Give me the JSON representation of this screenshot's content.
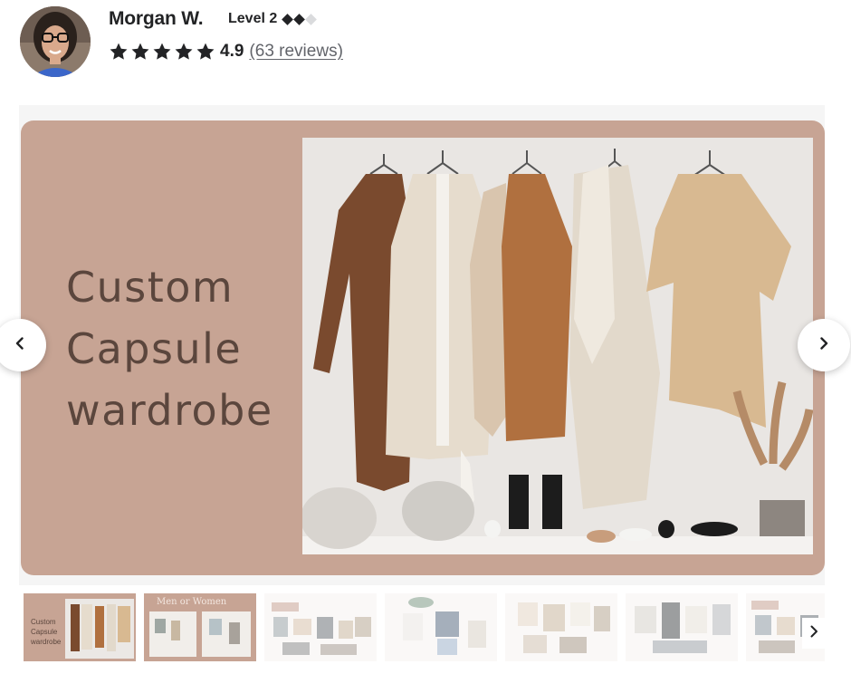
{
  "seller": {
    "name": "Morgan W.",
    "level_label": "Level 2",
    "level_diamonds_filled": 2,
    "level_diamonds_total": 3,
    "rating": "4.9",
    "stars": 5,
    "reviews_label": "(63 reviews)"
  },
  "gallery": {
    "slide_title_lines": [
      "Custom",
      "Capsule",
      "wardrobe"
    ],
    "slide_bg_color": "#c7a494",
    "title_color": "#5b463d",
    "thumbnails": [
      {
        "label": "Custom Capsule wardrobe",
        "lines": [
          "Custom",
          "Capsule",
          "wardrobe"
        ],
        "active": true
      },
      {
        "label": "Men or Women",
        "active": false
      },
      {
        "label": "",
        "active": false
      },
      {
        "label": "",
        "active": false
      },
      {
        "label": "",
        "active": false
      },
      {
        "label": "",
        "active": false
      },
      {
        "label": "",
        "active": false
      }
    ]
  },
  "icons": {
    "prev": "chevron-left-icon",
    "next": "chevron-right-icon",
    "star": "star-icon",
    "diamond": "diamond-icon"
  }
}
